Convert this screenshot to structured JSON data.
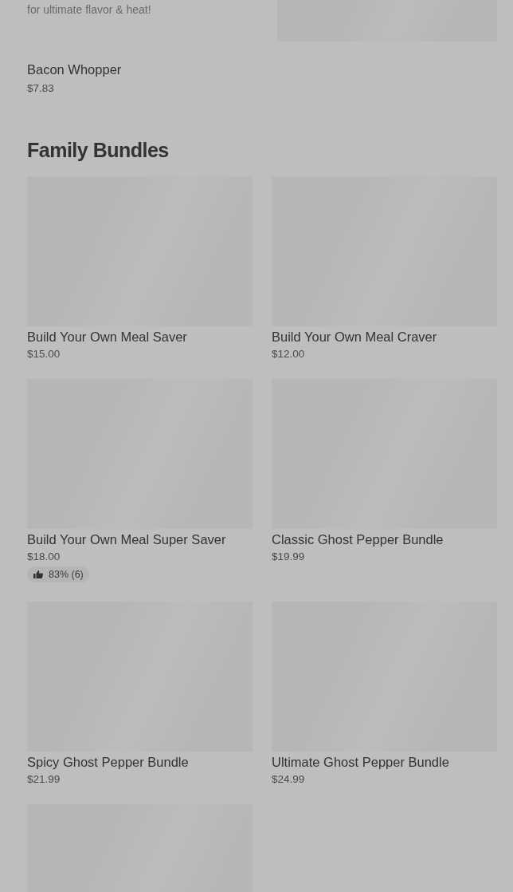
{
  "top_item": {
    "description": "for ultimate flavor & heat!"
  },
  "item": {
    "name": "Bacon Whopper",
    "price": "$7.83"
  },
  "section": {
    "title": "Family Bundles",
    "items": [
      {
        "kind": "product",
        "name": "Build Your Own Meal Saver",
        "price": "$15.00"
      },
      {
        "kind": "product",
        "name": "Build Your Own Meal Craver",
        "price": "$12.00"
      },
      {
        "kind": "product",
        "name": "Build Your Own Meal Super Saver",
        "price": "$18.00",
        "rating": "83% (6)"
      },
      {
        "kind": "product",
        "name": "Classic Ghost Pepper Bundle",
        "price": "$19.99"
      },
      {
        "kind": "product",
        "name": "Spicy Ghost Pepper Bundle",
        "price": "$21.99"
      },
      {
        "kind": "product",
        "name": "Ultimate Ghost Pepper Bundle",
        "price": "$24.99"
      },
      {
        "kind": "image_only"
      }
    ]
  }
}
